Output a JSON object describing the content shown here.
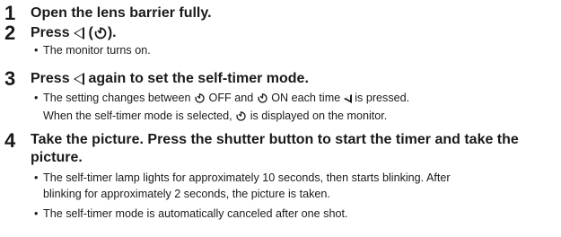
{
  "steps": [
    {
      "number": "1",
      "title": "Open the lens barrier fully."
    },
    {
      "number": "2",
      "title_a": "Press",
      "title_b": "(",
      "title_c": ").",
      "bullets": [
        "The monitor turns on."
      ]
    },
    {
      "number": "3",
      "title_a": "Press",
      "title_b": "again to set the self-timer mode.",
      "bullet1_a": "The setting changes between",
      "bullet1_b": "OFF and",
      "bullet1_c": "ON each time",
      "bullet1_d": "is pressed.",
      "bullet2_a": "When the self-timer mode is selected,",
      "bullet2_b": "is displayed on the monitor."
    },
    {
      "number": "4",
      "title": "Take the picture. Press the shutter button to start the timer and take the picture.",
      "bullets": [
        "The self-timer lamp lights for approximately 10 seconds, then starts blinking. After",
        "blinking for approximately 2 seconds, the picture is taken.",
        "The self-timer mode is automatically canceled after one shot."
      ]
    }
  ],
  "bullet_char": "•",
  "icons": {
    "left_button": "left-triangle-icon",
    "self_timer": "self-timer-icon"
  }
}
